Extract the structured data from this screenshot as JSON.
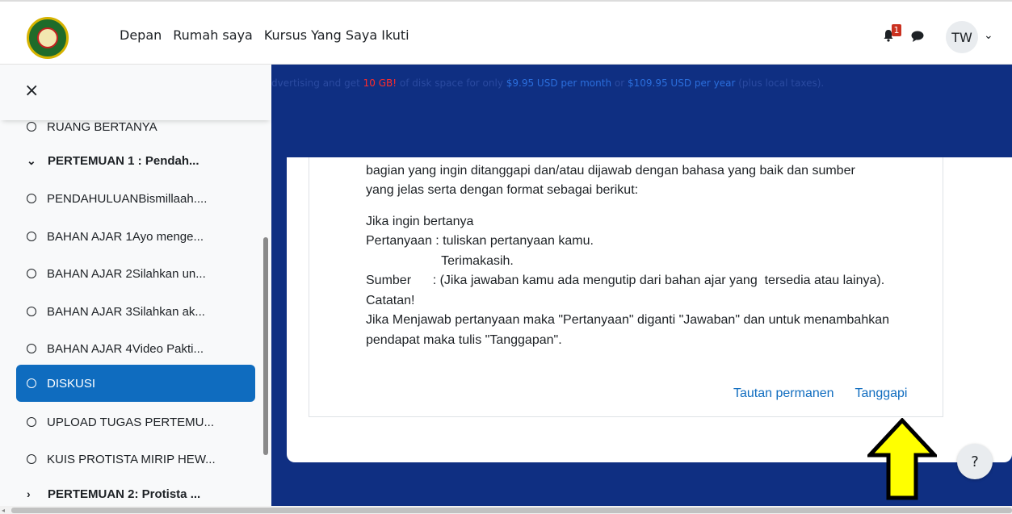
{
  "nav": {
    "links": [
      "Depan",
      "Rumah saya",
      "Kursus Yang Saya Ikuti"
    ],
    "notification_count": "1",
    "user_initials": "TW"
  },
  "ad": {
    "part1": "dvertising and get ",
    "highlight": "10 GB!",
    "part2": " of disk space for only ",
    "price_month": "$9.95 USD per month",
    "part3": " or ",
    "price_year": "$109.95 USD per year",
    "part4": " (plus local taxes)."
  },
  "sidebar": {
    "close_icon": "×",
    "items": [
      {
        "label": "RUANG BERTANYA",
        "type": "activity"
      },
      {
        "label": "PERTEMUAN 1 : Pendah...",
        "type": "section-expanded"
      },
      {
        "label": "PENDAHULUANBismillaah....",
        "type": "activity"
      },
      {
        "label": "BAHAN AJAR 1Ayo menge...",
        "type": "activity"
      },
      {
        "label": "BAHAN AJAR 2Silahkan un...",
        "type": "activity"
      },
      {
        "label": "BAHAN AJAR 3Silahkan ak...",
        "type": "activity"
      },
      {
        "label": "BAHAN AJAR 4Video Pakti...",
        "type": "activity"
      },
      {
        "label": "DISKUSI",
        "type": "activity",
        "active": true
      },
      {
        "label": "UPLOAD TUGAS PERTEMU...",
        "type": "activity"
      },
      {
        "label": "KUIS PROTISTA MIRIP HEW...",
        "type": "activity"
      },
      {
        "label": "PERTEMUAN 2: Protista ...",
        "type": "section-collapsed"
      }
    ]
  },
  "post": {
    "lines": [
      "bagian yang ingin ditanggapi dan/atau dijawab dengan bahasa yang baik dan sumber",
      "yang jelas serta dengan format sebagai berikut:",
      "",
      "Jika ingin bertanya",
      "Pertanyaan : tuliskan pertanyaan kamu.",
      "                     Terimakasih.",
      "Sumber      : (Jika jawaban kamu ada mengutip dari bahan ajar yang  tersedia atau lainya).",
      "Catatan!",
      "Jika Menjawab pertanyaan maka \"Pertanyaan\" diganti \"Jawaban\" dan untuk menambahkan",
      "pendapat maka tulis \"Tanggapan\"."
    ],
    "permalink_label": "Tautan permanen",
    "reply_label": "Tanggapi"
  },
  "help_label": "?",
  "colors": {
    "brand_blue": "#0f2f82",
    "link": "#0f6cbf",
    "active_item": "#0f6cbf",
    "arrow": "#ffff00"
  }
}
